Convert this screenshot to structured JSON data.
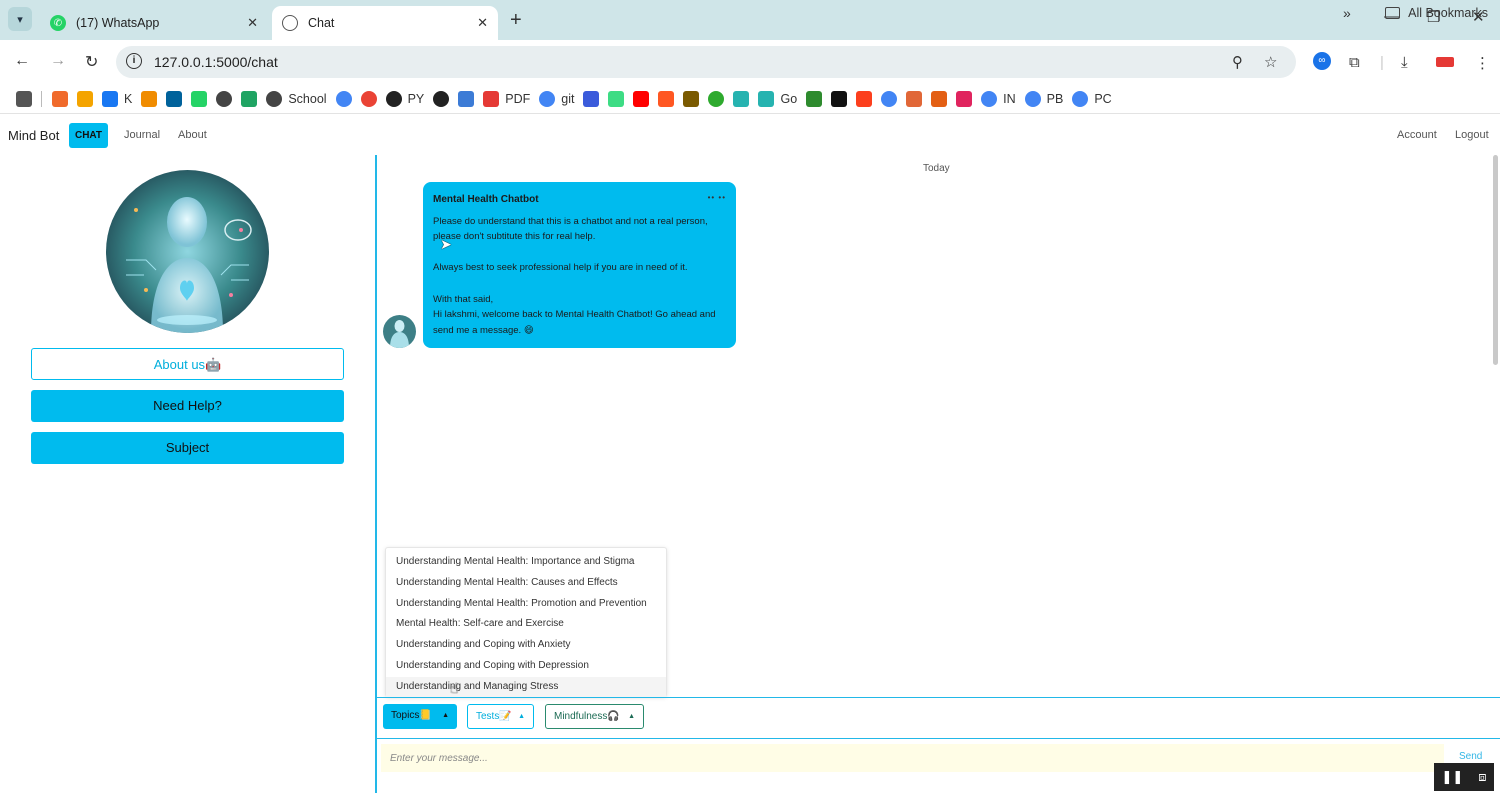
{
  "browser": {
    "tabs": [
      {
        "title": "(17) WhatsApp",
        "icon": "whatsapp-icon"
      },
      {
        "title": "Chat",
        "icon": "globe-icon",
        "active": true
      }
    ],
    "url": "127.0.0.1:5000/chat",
    "bookmarks": [
      {
        "label": "",
        "icon": "app-grid-icon",
        "color": "#555555"
      },
      {
        "label": "",
        "icon": "diamond-icon",
        "color": "#f06a2b"
      },
      {
        "label": "",
        "icon": "orange-square-icon",
        "color": "#f4a400"
      },
      {
        "label": "K",
        "icon": "facebook-icon",
        "color": "#1877f2"
      },
      {
        "label": "",
        "icon": "bar-chart-icon",
        "color": "#f08c00"
      },
      {
        "label": "",
        "icon": "ieee-icon",
        "color": "#00629b"
      },
      {
        "label": "",
        "icon": "whatsapp-icon",
        "color": "#25d366"
      },
      {
        "label": "",
        "icon": "globe-icon",
        "color": "#444444"
      },
      {
        "label": "",
        "icon": "sheets-icon",
        "color": "#1fa463"
      },
      {
        "label": "School",
        "icon": "globe-icon",
        "color": "#444444"
      },
      {
        "label": "",
        "icon": "google-icon",
        "color": "#4285f4"
      },
      {
        "label": "",
        "icon": "google-icon",
        "color": "#ea4335"
      },
      {
        "label": "PY",
        "icon": "github-icon",
        "color": "#222222"
      },
      {
        "label": "",
        "icon": "openai-icon",
        "color": "#222222"
      },
      {
        "label": "",
        "icon": "swirl-icon",
        "color": "#3c7bd6"
      },
      {
        "label": "PDF",
        "icon": "pdf-icon",
        "color": "#e53935"
      },
      {
        "label": "git",
        "icon": "google-icon",
        "color": "#4285f4"
      },
      {
        "label": "",
        "icon": "blue-bracket-icon",
        "color": "#3b5bdb"
      },
      {
        "label": "",
        "icon": "android-icon",
        "color": "#3ddc84"
      },
      {
        "label": "",
        "icon": "youtube-icon",
        "color": "#ff0000"
      },
      {
        "label": "",
        "icon": "z-icon",
        "color": "#ff5722"
      },
      {
        "label": "",
        "icon": "box-icon",
        "color": "#7a5a00"
      },
      {
        "label": "",
        "icon": "ring-icon",
        "color": "#2eaa2e"
      },
      {
        "label": "",
        "icon": "teal-leaf-icon",
        "color": "#26b3b0"
      },
      {
        "label": "Go",
        "icon": "teal-leaf-icon",
        "color": "#26b3b0"
      },
      {
        "label": "",
        "icon": "green-square-icon",
        "color": "#2e8b2e"
      },
      {
        "label": "",
        "icon": "c-square-icon",
        "color": "#111111"
      },
      {
        "label": "",
        "icon": "yandex-icon",
        "color": "#fc3f1d"
      },
      {
        "label": "",
        "icon": "google-icon",
        "color": "#4285f4"
      },
      {
        "label": "",
        "icon": "matlab-icon",
        "color": "#e16737"
      },
      {
        "label": "",
        "icon": "eye-icon",
        "color": "#e35f14"
      },
      {
        "label": "",
        "icon": "heart-icon",
        "color": "#e0245e"
      },
      {
        "label": "IN",
        "icon": "google-icon",
        "color": "#4285f4"
      },
      {
        "label": "PB",
        "icon": "google-icon",
        "color": "#4285f4"
      },
      {
        "label": "PC",
        "icon": "google-icon",
        "color": "#4285f4"
      }
    ],
    "all_bookmarks": "All Bookmarks"
  },
  "nav": {
    "brand": "Mind Bot",
    "chat": "CHAT",
    "journal": "Journal",
    "about": "About",
    "account": "Account",
    "logout": "Logout"
  },
  "sidebar": {
    "about_us": "About us🤖",
    "need_help": "Need Help?",
    "subject": "Subject"
  },
  "chat": {
    "date_label": "Today",
    "message": {
      "sender": "Mental Health Chatbot",
      "time": "•• ••",
      "lines": [
        "Please do understand that this is a chatbot and not a real person, please don't subtitute this for real help.",
        "Always best to seek professional help if you are in need of it.",
        "With that said,",
        "Hi lakshmi, welcome back to Mental Health Chatbot! Go ahead and send me a message. 😄"
      ]
    },
    "topics_menu": [
      "Understanding Mental Health: Importance and Stigma",
      "Understanding Mental Health: Causes and Effects",
      "Understanding Mental Health: Promotion and Prevention",
      "Mental Health: Self-care and Exercise",
      "Understanding and Coping with Anxiety",
      "Understanding and Coping with Depression",
      "Understanding and Managing Stress"
    ],
    "toolbar": {
      "topics": "Topics📒",
      "tests": "Tests📝",
      "mindfulness": "Mindfulness🎧"
    },
    "input_placeholder": "Enter your message...",
    "send": "Send"
  },
  "colors": {
    "accent": "#00bbee",
    "mindfulness": "#2a8a6e",
    "input_bg": "#fffde6",
    "tabbar": "#cfe5e8"
  }
}
